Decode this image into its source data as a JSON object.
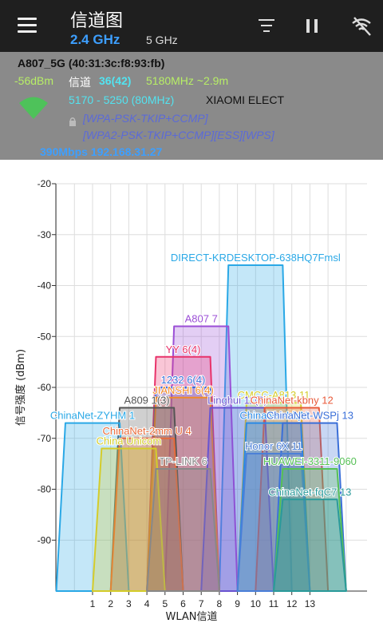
{
  "app": {
    "title": "信道图",
    "tabs": [
      {
        "label": "2.4 GHz",
        "selected": true
      },
      {
        "label": "5 GHz",
        "selected": false
      }
    ],
    "icons": [
      "menu-icon",
      "filter-icon",
      "pause-icon",
      "wifi-off-icon"
    ]
  },
  "connected": {
    "ssid_line": "A807_5G (40:31:3c:f8:93:fb)",
    "rssi": "-56dBm",
    "channel_label": "信道",
    "channel": "36(42)",
    "freq_distance": "5180MHz ~2.9m",
    "range": "5170 - 5250 (80MHz)",
    "vendor": "XIAOMI ELECT",
    "security1": "[WPA-PSK-TKIP+CCMP]",
    "security2": "[WPA2-PSK-TKIP+CCMP][ESS][WPS]",
    "speed_ip": "390Mbps 192.168.31.27"
  },
  "chart_data": {
    "type": "area",
    "xlabel": "WLAN信道",
    "ylabel": "信号强度 (dBm)",
    "x_ticks": [
      "1",
      "2",
      "3",
      "4",
      "5",
      "6",
      "7",
      "8",
      "9",
      "10",
      "11",
      "12",
      "13"
    ],
    "y_ticks": [
      "-20",
      "-30",
      "-40",
      "-50",
      "-60",
      "-70",
      "-80",
      "-90"
    ],
    "ylim": [
      -100,
      -20
    ],
    "series": [
      {
        "name": "DIRECT-KRDESKTOP-638HQ7Fmsl",
        "channel": 10,
        "dbm": -36,
        "color": "#2aa8e6"
      },
      {
        "name": "A807 7",
        "channel": 7,
        "dbm": -48,
        "color": "#9b4fd6"
      },
      {
        "name": "YY 6(4)",
        "channel": 6,
        "dbm": -54,
        "color": "#e8336a"
      },
      {
        "name": "1232 6(4)",
        "channel": 6,
        "dbm": -60,
        "color": "#3a6fd8"
      },
      {
        "name": "JIANSHI 6(4)",
        "channel": 6,
        "dbm": -62,
        "color": "#f08a2a"
      },
      {
        "name": "A809 1(3)",
        "channel": 4,
        "dbm": -64,
        "color": "#555555"
      },
      {
        "name": "Linghui 11(9)",
        "channel": 9,
        "dbm": -64,
        "color": "#6a55d0"
      },
      {
        "name": "CMCC-A813 11",
        "channel": 11,
        "dbm": -63,
        "color": "#d4cc2a"
      },
      {
        "name": "ChinaNet-kbny 12",
        "channel": 12,
        "dbm": -64,
        "color": "#e85a3a"
      },
      {
        "name": "ChinaNet-ZYHM 1",
        "channel": 1,
        "dbm": -67,
        "color": "#2aa8e6"
      },
      {
        "name": "ChinaNet-LiqN",
        "channel": 11,
        "dbm": -67,
        "color": "#2a8ae6"
      },
      {
        "name": "ChinaNet-WSPj 13",
        "channel": 13,
        "dbm": -67,
        "color": "#3a6fd8"
      },
      {
        "name": "ChinaNet-2mm U 4",
        "channel": 4,
        "dbm": -70,
        "color": "#e86a3a"
      },
      {
        "name": "China Unicom",
        "channel": 3,
        "dbm": -72,
        "color": "#d4cc2a"
      },
      {
        "name": "Honor 6X 11",
        "channel": 11,
        "dbm": -73,
        "color": "#4a7fd8"
      },
      {
        "name": "TP-LINK 6",
        "channel": 6,
        "dbm": -76,
        "color": "#888888"
      },
      {
        "name": "HUAWEI-3311-9060",
        "channel": 13,
        "dbm": -76,
        "color": "#56c056"
      },
      {
        "name": "ChinaNet-fqC7 13",
        "channel": 13,
        "dbm": -82,
        "color": "#2a9a9a"
      }
    ]
  }
}
